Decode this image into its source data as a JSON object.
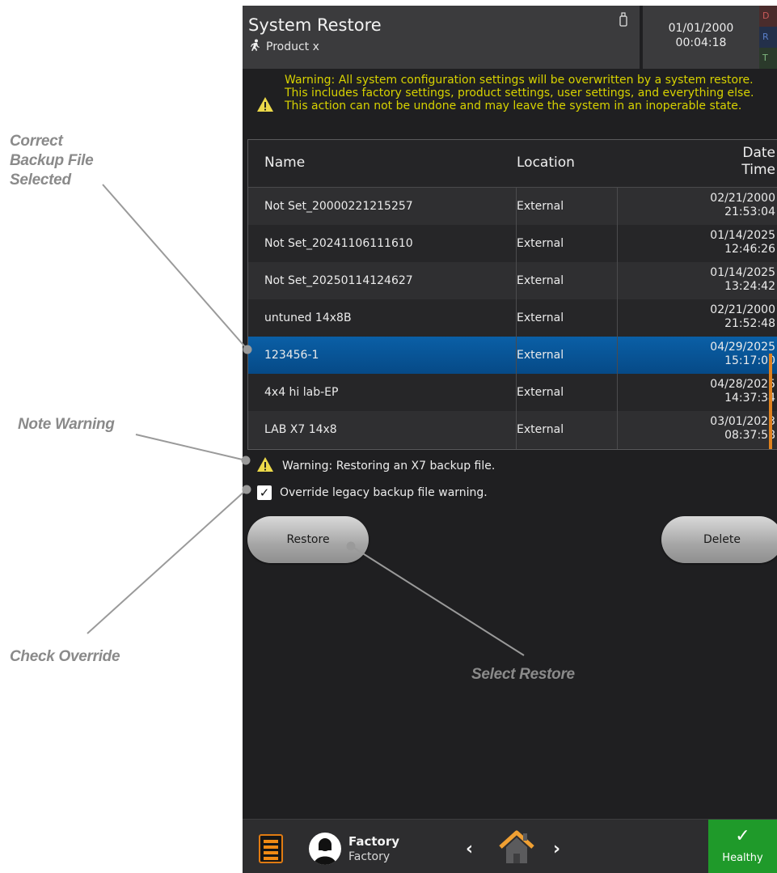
{
  "annotations": {
    "backup": [
      "Correct",
      "Backup File",
      "Selected"
    ],
    "note_warning": "Note Warning",
    "check_override": "Check Override",
    "select_restore": "Select Restore"
  },
  "header": {
    "title": "System Restore",
    "product": "Product x",
    "date": "01/01/2000",
    "time": "00:04:18",
    "strip_letters": [
      "D",
      "R",
      "T"
    ]
  },
  "warning_top": "Warning: All system configuration settings will be overwritten by a system restore. This includes factory settings, product settings, user settings, and everything else. This action can not be undone and may leave the system in an inoperable state.",
  "table": {
    "headers": {
      "name": "Name",
      "location": "Location",
      "date": "Date",
      "time": "Time"
    },
    "rows": [
      {
        "name": "Not Set_20000221215257",
        "location": "External",
        "date": "02/21/2000",
        "time": "21:53:04",
        "selected": false
      },
      {
        "name": "Not Set_20241106111610",
        "location": "External",
        "date": "01/14/2025",
        "time": "12:46:26",
        "selected": false
      },
      {
        "name": "Not Set_20250114124627",
        "location": "External",
        "date": "01/14/2025",
        "time": "13:24:42",
        "selected": false
      },
      {
        "name": "untuned 14x8B",
        "location": "External",
        "date": "02/21/2000",
        "time": "21:52:48",
        "selected": false
      },
      {
        "name": "123456-1",
        "location": "External",
        "date": "04/29/2025",
        "time": "15:17:00",
        "selected": true
      },
      {
        "name": "4x4 hi lab-EP",
        "location": "External",
        "date": "04/28/2025",
        "time": "14:37:34",
        "selected": false
      },
      {
        "name": "LAB X7 14x8",
        "location": "External",
        "date": "03/01/2023",
        "time": "08:37:58",
        "selected": false
      }
    ]
  },
  "warning_x7": "Warning: Restoring an X7 backup file.",
  "override": {
    "label": "Override legacy backup file warning.",
    "checked": true,
    "mark": "✓"
  },
  "buttons": {
    "restore": "Restore",
    "delete": "Delete"
  },
  "footer": {
    "user_name": "Factory",
    "user_role": "Factory",
    "prev": "‹",
    "next": "›",
    "health_mark": "✓",
    "health": "Healthy"
  },
  "colors": {
    "accent_orange": "#f08a14",
    "warning_yellow": "#d7d200",
    "selection_blue": "#0a5fa6",
    "healthy_green": "#1f9a2a"
  }
}
